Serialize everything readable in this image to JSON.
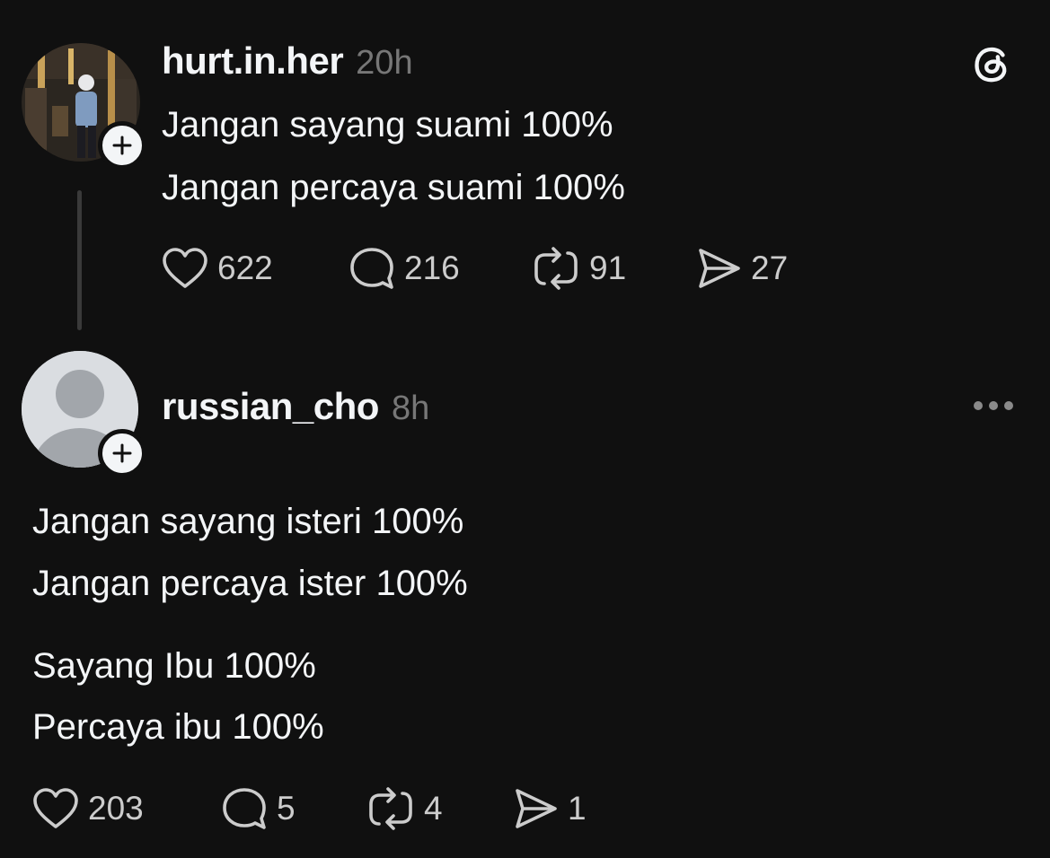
{
  "posts": [
    {
      "username": "hurt.in.her",
      "time": "20h",
      "lines": [
        "Jangan sayang suami 100%",
        "Jangan percaya suami 100%"
      ],
      "stats": {
        "likes": "622",
        "replies": "216",
        "reposts": "91",
        "shares": "27"
      }
    },
    {
      "username": "russian_cho",
      "time": "8h",
      "lines": [
        "Jangan sayang isteri 100%",
        "Jangan percaya ister 100%",
        "Sayang Ibu 100%",
        "Percaya ibu 100%"
      ],
      "stats": {
        "likes": "203",
        "replies": "5",
        "reposts": "4",
        "shares": "1"
      }
    }
  ],
  "icons": {
    "app": "threads-logo-icon",
    "like": "heart-icon",
    "reply": "speech-bubble-icon",
    "repost": "repost-icon",
    "share": "send-icon",
    "follow": "plus-icon",
    "more": "more-options-icon"
  },
  "colors": {
    "background": "#101010",
    "text": "#f3f5f7",
    "muted": "#777777",
    "thread_line": "#3a3a3a"
  }
}
